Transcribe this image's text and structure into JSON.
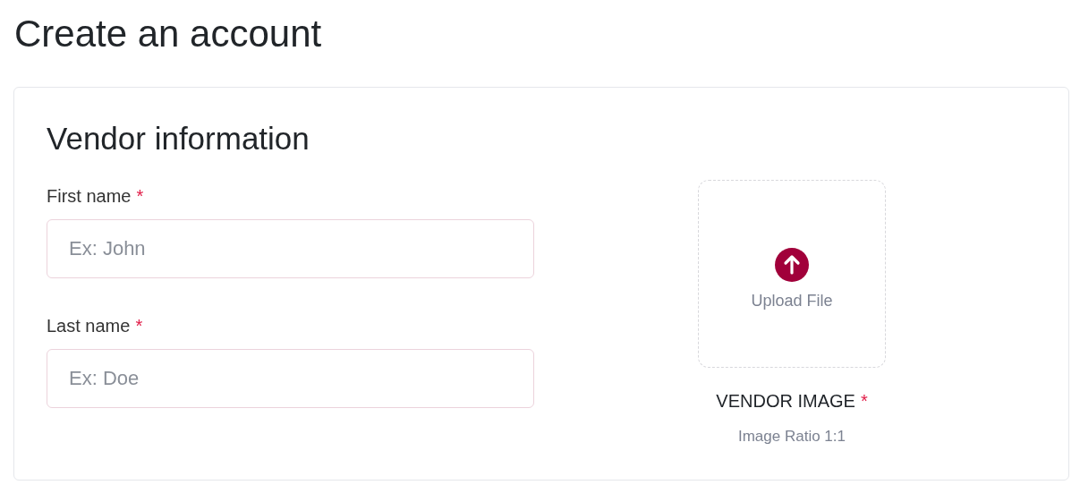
{
  "page_title": "Create an account",
  "card": {
    "title": "Vendor information",
    "fields": [
      {
        "label": "First name",
        "required_mark": "*",
        "placeholder": "Ex: John"
      },
      {
        "label": "Last name",
        "required_mark": "*",
        "placeholder": "Ex: Doe"
      }
    ],
    "upload": {
      "button_label": "Upload File",
      "label": "VENDOR IMAGE",
      "required_mark": "*",
      "hint": "Image Ratio 1:1"
    }
  }
}
